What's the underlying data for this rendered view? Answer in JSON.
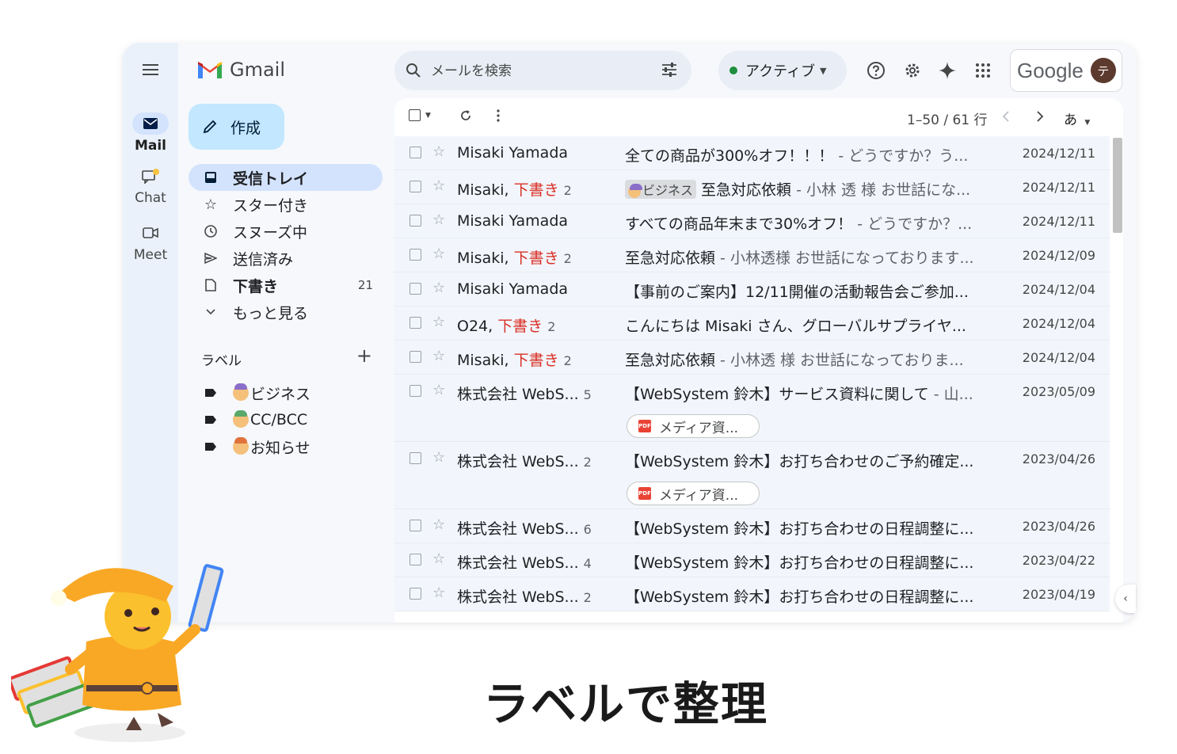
{
  "app": {
    "brand": "Gmail",
    "google_word": "Google",
    "avatar_initial": "テ"
  },
  "rail": [
    {
      "label": "Mail",
      "icon": "mail-icon",
      "active": true
    },
    {
      "label": "Chat",
      "icon": "chat-icon",
      "active": false
    },
    {
      "label": "Meet",
      "icon": "video-icon",
      "active": false
    }
  ],
  "compose": {
    "label": "作成"
  },
  "nav": [
    {
      "label": "受信トレイ",
      "icon": "inbox-icon",
      "count": "",
      "active": true
    },
    {
      "label": "スター付き",
      "icon": "star-icon",
      "count": ""
    },
    {
      "label": "スヌーズ中",
      "icon": "clock-icon",
      "count": ""
    },
    {
      "label": "送信済み",
      "icon": "send-icon",
      "count": ""
    },
    {
      "label": "下書き",
      "icon": "draft-icon",
      "count": "21"
    },
    {
      "label": "もっと見る",
      "icon": "chevron-down-icon",
      "count": ""
    }
  ],
  "labels": {
    "heading": "ラベル",
    "items": [
      {
        "label": "ビジネス"
      },
      {
        "label": "CC/BCC"
      },
      {
        "label": "お知らせ"
      }
    ]
  },
  "search": {
    "placeholder": "メールを検索"
  },
  "status": {
    "label": "アクティブ"
  },
  "toolbar": {
    "range": "1–50 / 61 行",
    "input_lang": "あ"
  },
  "emails": [
    {
      "from": "Misaki Yamada",
      "draft": "",
      "num": "",
      "chip": "",
      "subject": "全ての商品が300%オフ！！！",
      "snippet": " - どうですか？う...",
      "date": "2024/12/11",
      "attach": ""
    },
    {
      "from": "Misaki, ",
      "draft": "下書き",
      "num": "2",
      "chip": "ビジネス",
      "subject": "至急対応依頼",
      "snippet": " - 小林 透 様 お世話にな...",
      "date": "2024/12/11",
      "attach": ""
    },
    {
      "from": "Misaki Yamada",
      "draft": "",
      "num": "",
      "chip": "",
      "subject": "すべての商品年末まで30%オフ！",
      "snippet": " - どうですか？...",
      "date": "2024/12/11",
      "attach": ""
    },
    {
      "from": "Misaki, ",
      "draft": "下書き",
      "num": "2",
      "chip": "",
      "subject": "至急対応依頼",
      "snippet": " - 小林透様 お世話になっております...",
      "date": "2024/12/09",
      "attach": ""
    },
    {
      "from": "Misaki Yamada",
      "draft": "",
      "num": "",
      "chip": "",
      "subject": "【事前のご案内】12/11開催の活動報告会ご参加...",
      "snippet": "",
      "date": "2024/12/04",
      "attach": ""
    },
    {
      "from": "O24, ",
      "draft": "下書き",
      "num": "2",
      "chip": "",
      "subject": "こんにちは Misaki さん、グローバルサプライヤ...",
      "snippet": "",
      "date": "2024/12/04",
      "attach": ""
    },
    {
      "from": "Misaki, ",
      "draft": "下書き",
      "num": "2",
      "chip": "",
      "subject": "至急対応依頼",
      "snippet": " - 小林透 様 お世話になっておりま...",
      "date": "2024/12/04",
      "attach": ""
    },
    {
      "from": "株式会社 WebS...",
      "draft": "",
      "num": "5",
      "chip": "",
      "subject": "【WebSystem 鈴木】サービス資料に関して",
      "snippet": " - 山...",
      "date": "2023/05/09",
      "attach": "メディア資..."
    },
    {
      "from": "株式会社 WebS...",
      "draft": "",
      "num": "2",
      "chip": "",
      "subject": "【WebSystem 鈴木】お打ち合わせのご予約確定...",
      "snippet": "",
      "date": "2023/04/26",
      "attach": "メディア資..."
    },
    {
      "from": "株式会社 WebS...",
      "draft": "",
      "num": "6",
      "chip": "",
      "subject": "【WebSystem 鈴木】お打ち合わせの日程調整に...",
      "snippet": "",
      "date": "2023/04/26",
      "attach": ""
    },
    {
      "from": "株式会社 WebS...",
      "draft": "",
      "num": "4",
      "chip": "",
      "subject": "【WebSystem 鈴木】お打ち合わせの日程調整に...",
      "snippet": "",
      "date": "2023/04/22",
      "attach": ""
    },
    {
      "from": "株式会社 WebS...",
      "draft": "",
      "num": "2",
      "chip": "",
      "subject": "【WebSystem 鈴木】お打ち合わせの日程調整に...",
      "snippet": "",
      "date": "2023/04/19",
      "attach": ""
    }
  ],
  "caption": "ラベルで整理",
  "colors": {
    "accent": "#c2e7ff",
    "active_nav": "#d3e3fd",
    "draft_red": "#d93025",
    "bg": "#f6f8fc"
  }
}
